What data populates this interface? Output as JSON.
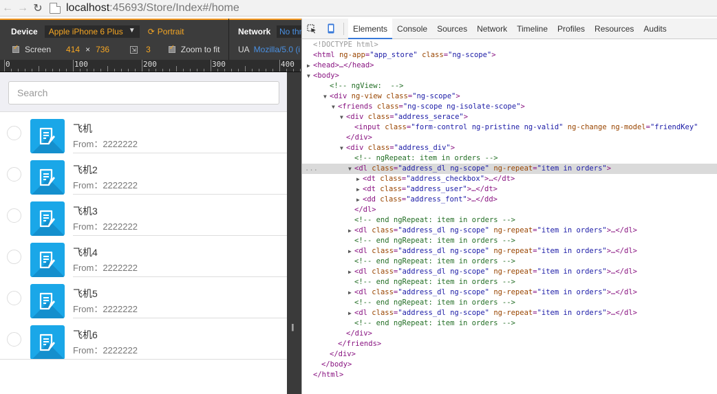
{
  "browser": {
    "url_host": "localhost",
    "url_rest": ":45693/Store/Index#/home"
  },
  "emulation": {
    "device_label": "Device",
    "device_value": "Apple iPhone 6 Plus",
    "orientation": "Portrait",
    "screen_label": "Screen",
    "width": "414",
    "times": "×",
    "height": "736",
    "dpr": "3",
    "zoom_label": "Zoom to fit",
    "network_label": "Network",
    "network_value": "No thr",
    "ua_label": "UA",
    "ua_value": "Mozilla/5.0 (i"
  },
  "ruler": {
    "labels": [
      "0",
      "100",
      "200",
      "300",
      "400"
    ]
  },
  "app": {
    "search_placeholder": "Search",
    "items": [
      {
        "name": "飞机",
        "from": "From：2222222"
      },
      {
        "name": "飞机2",
        "from": "From：2222222"
      },
      {
        "name": "飞机3",
        "from": "From：2222222"
      },
      {
        "name": "飞机4",
        "from": "From：2222222"
      },
      {
        "name": "飞机5",
        "from": "From：2222222"
      },
      {
        "name": "飞机6",
        "from": "From：2222222"
      }
    ]
  },
  "devtools": {
    "tabs": [
      "Elements",
      "Console",
      "Sources",
      "Network",
      "Timeline",
      "Profiles",
      "Resources",
      "Audits"
    ],
    "active_tab": "Elements",
    "dom_lines": [
      "<!DOCTYPE html>",
      "<html ng-app=\"app_store\" class=\"ng-scope\">",
      "<head>…</head>",
      "<body>",
      "<!-- ngView:  -->",
      "<div ng-view class=\"ng-scope\">",
      "<friends class=\"ng-scope ng-isolate-scope\">",
      "<div class=\"address_serace\">",
      "<input class=\"form-control ng-pristine ng-valid\" ng-change ng-model=\"friendKey\"",
      "</div>",
      "<div class=\"address_div\">",
      "<!-- ngRepeat: item in orders -->",
      "<dl class=\"address_dl ng-scope\" ng-repeat=\"item in orders\">",
      "<dt class=\"address_checkbox\">…</dt>",
      "<dt class=\"address_user\">…</dt>",
      "<dd class=\"address_font\">…</dd>",
      "</dl>",
      "<!-- end ngRepeat: item in orders -->",
      "<dl class=\"address_dl ng-scope\" ng-repeat=\"item in orders\">…</dl>",
      "<!-- end ngRepeat: item in orders -->",
      "<dl class=\"address_dl ng-scope\" ng-repeat=\"item in orders\">…</dl>",
      "<!-- end ngRepeat: item in orders -->",
      "<dl class=\"address_dl ng-scope\" ng-repeat=\"item in orders\">…</dl>",
      "<!-- end ngRepeat: item in orders -->",
      "<dl class=\"address_dl ng-scope\" ng-repeat=\"item in orders\">…</dl>",
      "<!-- end ngRepeat: item in orders -->",
      "<dl class=\"address_dl ng-scope\" ng-repeat=\"item in orders\">…</dl>",
      "<!-- end ngRepeat: item in orders -->",
      "</div>",
      "</friends>",
      "</div>",
      "</body>",
      "</html>"
    ],
    "line_ellipsis": "..."
  },
  "colors": {
    "accent_orange": "#f5a623",
    "app_icon_blue": "#1aa7e8",
    "devtools_tab_active": "#3879d9"
  }
}
